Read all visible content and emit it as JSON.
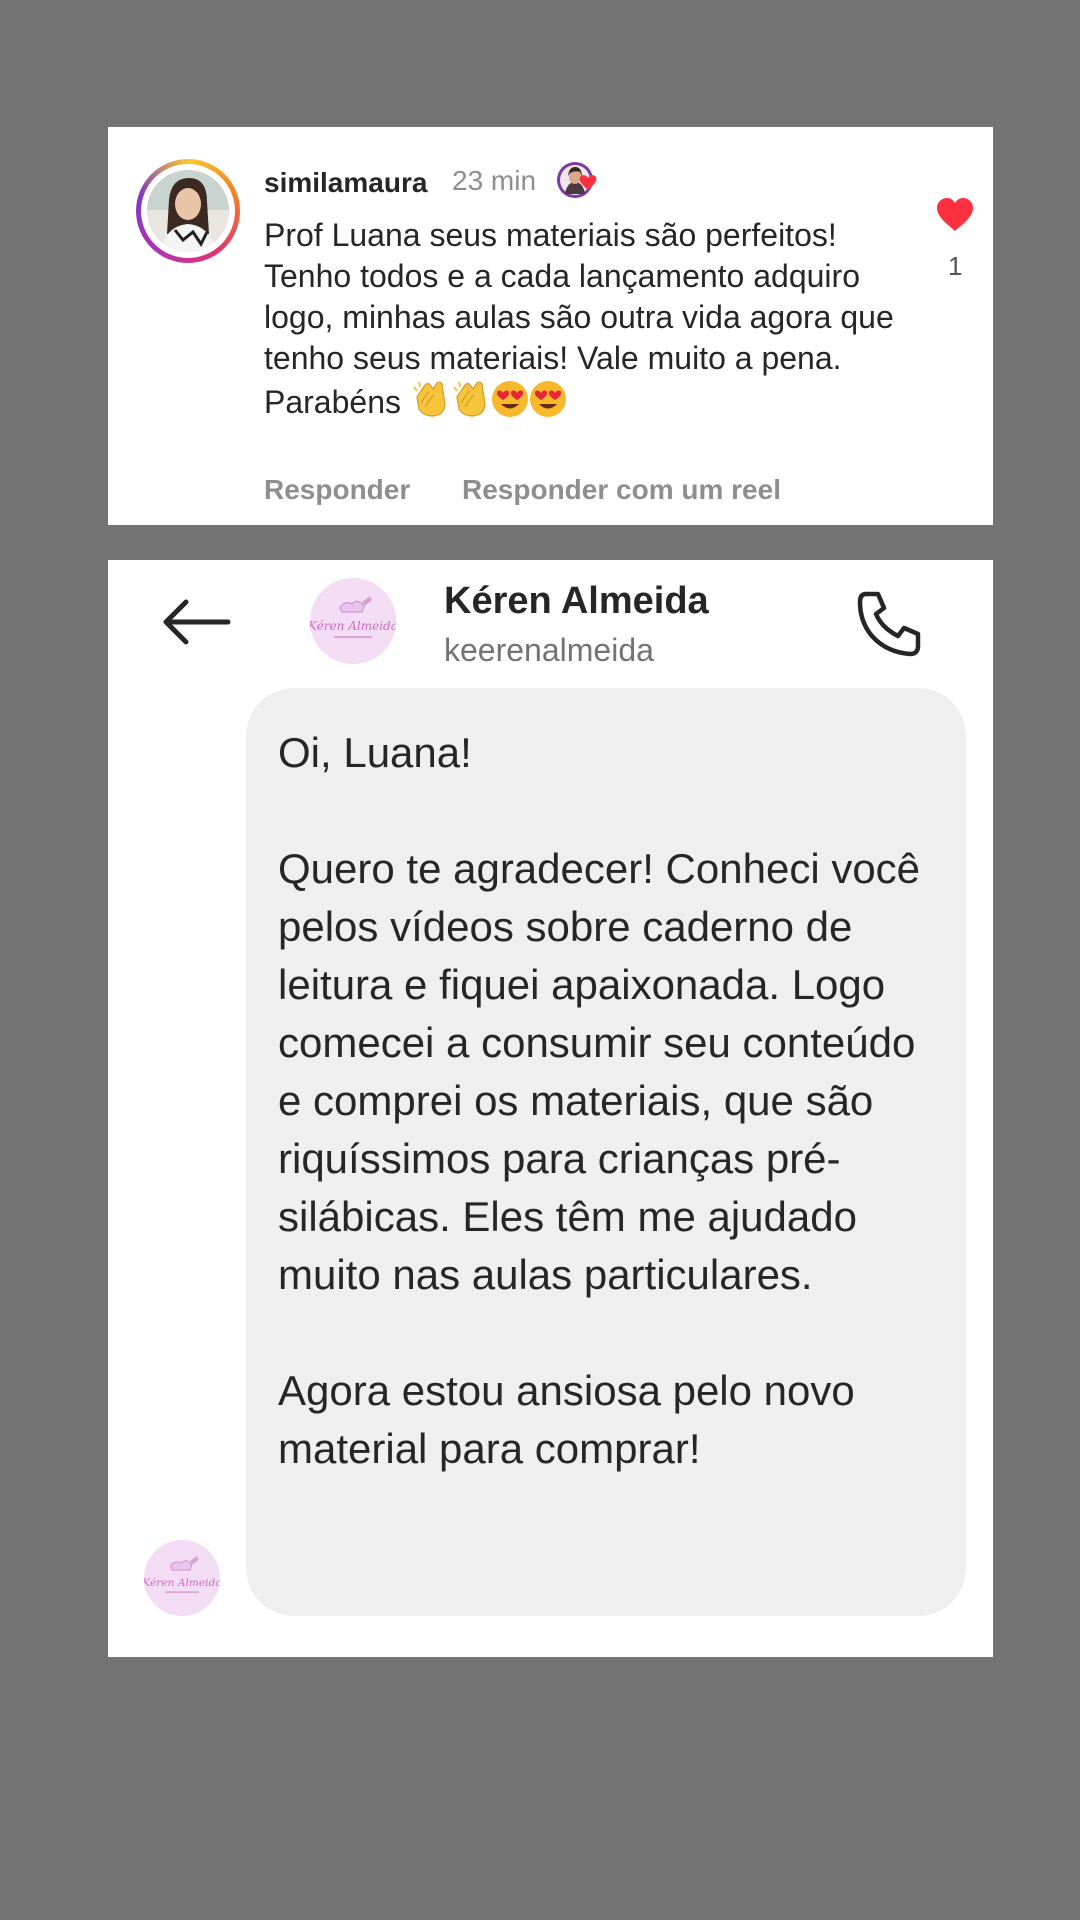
{
  "comment": {
    "username": "similamaura",
    "time": "23 min",
    "text": "Prof Luana seus materiais são perfeitos! Tenho todos e a cada lançamento adquiro logo, minhas aulas são outra vida agora que tenho seus materiais! Vale muito a pena. Parabéns",
    "emojis": [
      "clapping-hands",
      "clapping-hands",
      "heart-eyes",
      "heart-eyes"
    ],
    "reply_label": "Responder",
    "reply_reel_label": "Responder com um reel",
    "like_count": "1",
    "like_color": "#ff3040"
  },
  "dm": {
    "contact_name": "Kéren Almeida",
    "contact_handle": "keerenalmeida",
    "avatar_logo_text": "Kéren Almeida",
    "message_paragraphs": [
      "Oi, Luana!",
      "Quero te agradecer! Conheci você pelos vídeos sobre caderno de leitura e fiquei apaixonada. Logo comecei a consumir seu conteúdo e comprei os materiais, que são riquíssimos para crianças pré-silábicas. Eles têm me ajudado muito nas aulas particulares.",
      "Agora estou ansiosa pelo novo material para comprar!"
    ],
    "bubble_color": "#efefef"
  },
  "icons": {
    "back": "arrow-left-icon",
    "call": "phone-icon",
    "like": "heart-icon"
  }
}
